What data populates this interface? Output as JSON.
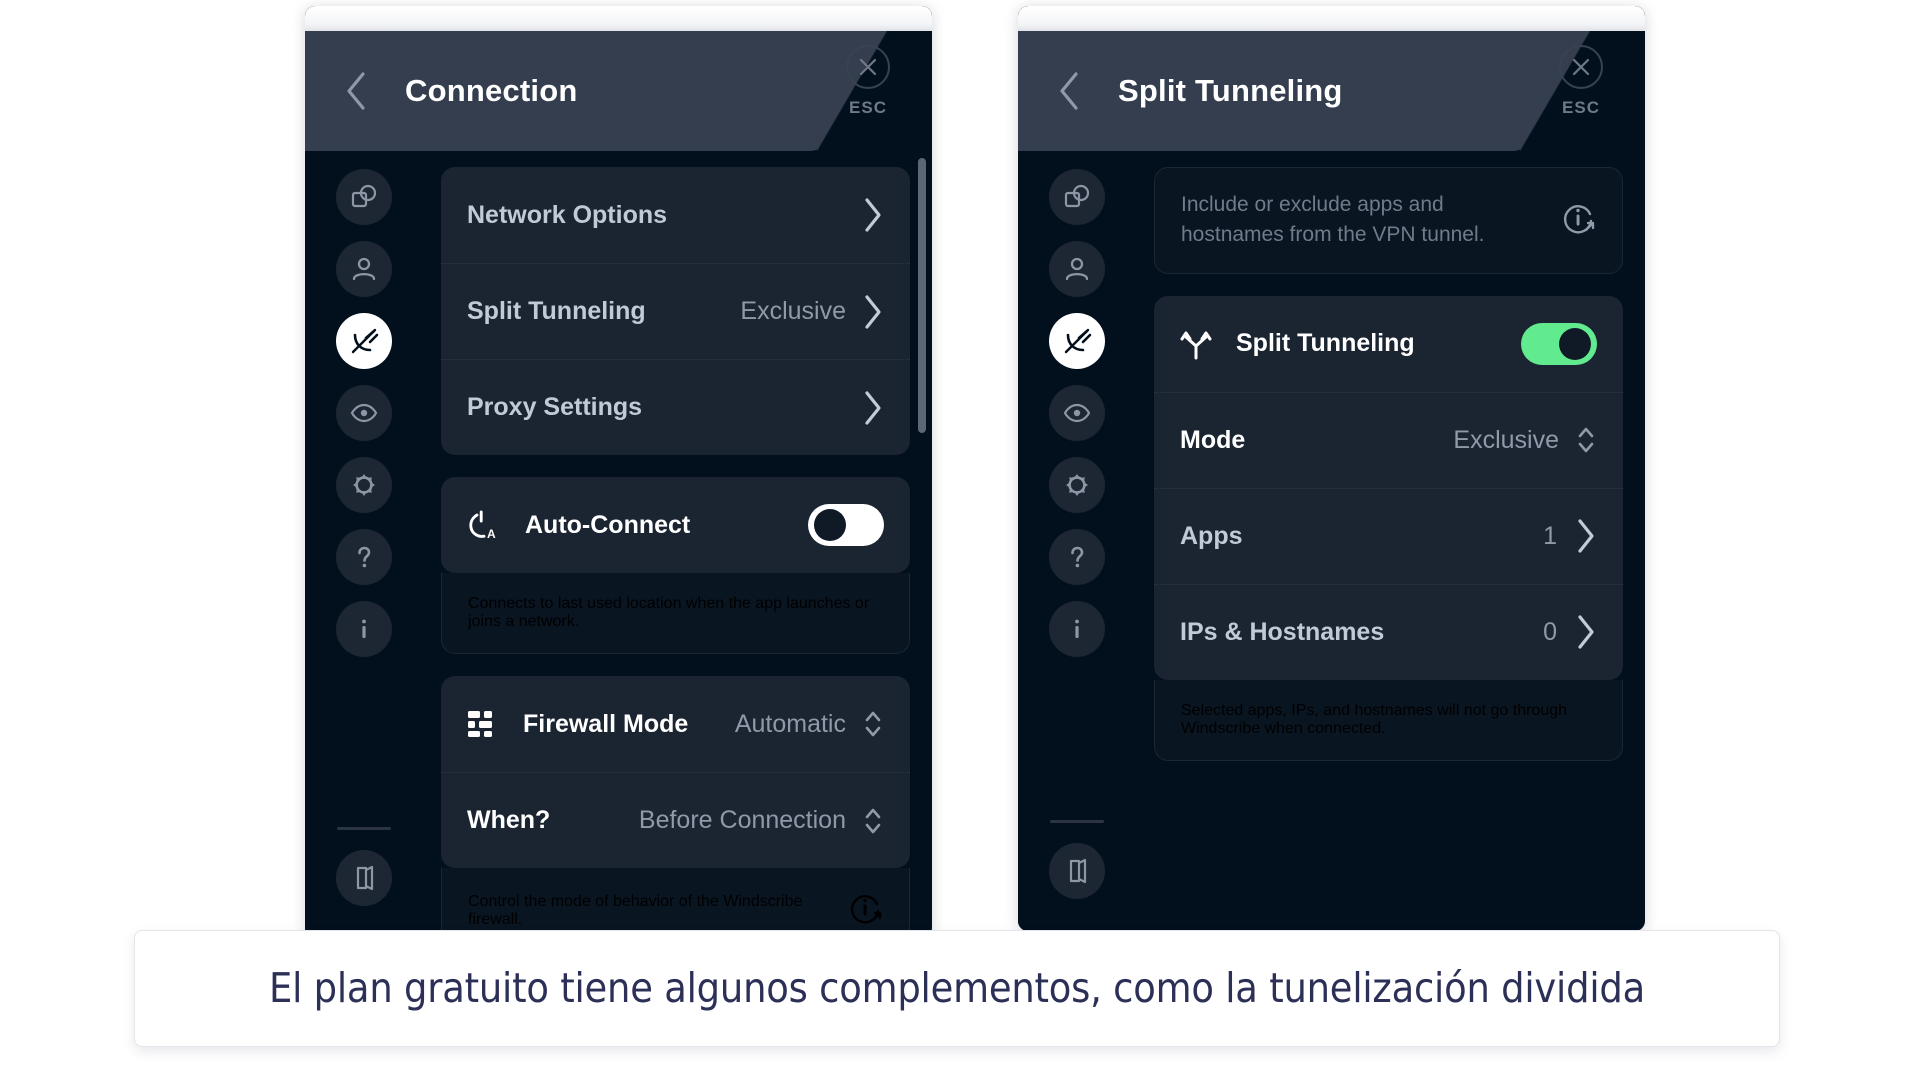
{
  "page": {
    "background": "#ffffff",
    "caption": "El plan gratuito tiene algunos complementos, como la tunelización dividida"
  },
  "colors": {
    "app_background": "#02101e",
    "card_background": "#1b2431",
    "header_slab": "#343e4f",
    "accent_green": "#62ea8f",
    "muted_text": "#8f99a8",
    "caption_text": "#2c3057"
  },
  "sidebar": {
    "items": [
      {
        "name": "general-icon",
        "label": "General",
        "active": false
      },
      {
        "name": "account-icon",
        "label": "Account",
        "active": false
      },
      {
        "name": "connection-icon",
        "label": "Connection",
        "active": true
      },
      {
        "name": "robert-icon",
        "label": "R.O.B.E.R.T.",
        "active": false
      },
      {
        "name": "preferences-icon",
        "label": "Preferences",
        "active": false
      },
      {
        "name": "help-icon",
        "label": "Help",
        "active": false
      },
      {
        "name": "about-icon",
        "label": "About",
        "active": false
      }
    ],
    "bottom_item": {
      "name": "logout-icon",
      "label": "Logout"
    }
  },
  "panel1": {
    "header": {
      "back_label": "Back",
      "title": "Connection",
      "esc_label": "ESC",
      "close_label": "Close"
    },
    "menu_rows": [
      {
        "label": "Network Options",
        "value": "",
        "chevron": true
      },
      {
        "label": "Split Tunneling",
        "value": "Exclusive",
        "chevron": true
      },
      {
        "label": "Proxy Settings",
        "value": "",
        "chevron": true
      }
    ],
    "auto_connect": {
      "icon": "power-auto-icon",
      "label": "Auto-Connect",
      "toggle_state": "off",
      "description": "Connects to last used location when the app launches or joins a network."
    },
    "firewall": {
      "icon": "firewall-icon",
      "label": "Firewall Mode",
      "value": "Automatic",
      "when_label": "When?",
      "when_value": "Before Connection",
      "description": "Control the mode of behavior of the Windscribe firewall."
    }
  },
  "panel2": {
    "header": {
      "back_label": "Back",
      "title": "Split Tunneling",
      "esc_label": "ESC",
      "close_label": "Close"
    },
    "intro": {
      "text": "Include or exclude apps and hostnames from the VPN tunnel.",
      "info_icon": "info-external-icon"
    },
    "split_tunneling": {
      "icon": "split-tunnel-icon",
      "label": "Split Tunneling",
      "toggle_state": "on"
    },
    "rows": [
      {
        "label": "Mode",
        "value": "Exclusive",
        "control": "stepper"
      },
      {
        "label": "Apps",
        "value": "1",
        "control": "chevron"
      },
      {
        "label": "IPs & Hostnames",
        "value": "0",
        "control": "chevron"
      }
    ],
    "footer_description": "Selected apps, IPs, and hostnames will not go through Windscribe when connected."
  }
}
